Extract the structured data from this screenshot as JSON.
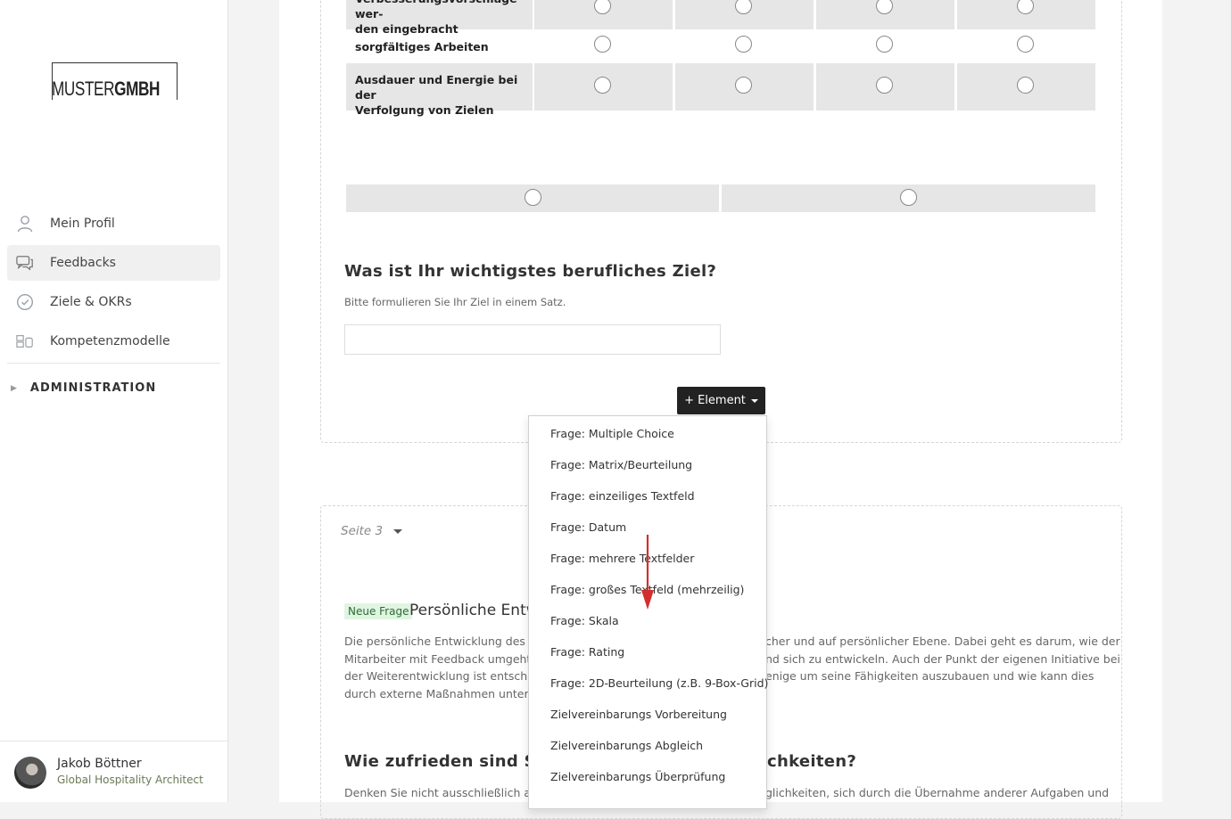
{
  "brand": {
    "logo_light": "MUSTER",
    "logo_bold": "GMBH"
  },
  "nav": {
    "items": [
      {
        "label": "Mein Profil",
        "icon": "user-icon"
      },
      {
        "label": "Feedbacks",
        "icon": "chat-icon",
        "active": true
      },
      {
        "label": "Ziele & OKRs",
        "icon": "check-circle-icon"
      },
      {
        "label": "Kompetenzmodelle",
        "icon": "blocks-icon"
      }
    ],
    "admin_label": "ADMINISTRATION"
  },
  "user": {
    "name": "Jakob Böttner",
    "role": "Global Hospitality Architect"
  },
  "matrix": {
    "rows": [
      {
        "label_line1": "Verbesserungsvorschläge wer-",
        "label_line2": "den eingebracht"
      },
      {
        "label_line1": "sorgfältiges Arbeiten",
        "label_line2": ""
      },
      {
        "label_line1": "Ausdauer und Energie bei der",
        "label_line2": "Verfolgung von Zielen"
      }
    ]
  },
  "question_goal": {
    "title": "Was ist Ihr wichtigstes berufliches Ziel?",
    "hint": "Bitte formulieren Sie Ihr Ziel in einem Satz.",
    "value": ""
  },
  "add_element": {
    "label": "+ Element",
    "menu": [
      "Frage: Multiple Choice",
      "Frage: Matrix/Beurteilung",
      "Frage: einzeiliges Textfeld",
      "Frage: Datum",
      "Frage: mehrere Textfelder",
      "Frage: großes Textfeld (mehrzeilig)",
      "Frage: Skala",
      "Frage: Rating",
      "Frage: 2D-Beurteilung (z.B. 9-Box-Grid)",
      "Zielvereinbarungs Vorbereitung",
      "Zielvereinbarungs Abgleich",
      "Zielvereinbarungs Überprüfung"
    ]
  },
  "page3": {
    "label": "Seite 3",
    "badge": "Neue Frage",
    "section_title": "Persönliche Entw",
    "para_left": [
      "Die persönliche Entwicklung des Mi",
      "Mitarbeiter mit Feedback umgeht u",
      "der Weiterentwicklung ist entscheid",
      "durch externe Maßnahmen unters"
    ],
    "para_right": [
      "cher und auf persönlicher Ebene. Dabei geht es darum, wie der",
      "nd sich zu entwickeln. Auch der Punkt der eigenen Initiative bei",
      "enige um seine Fähigkeiten auszubauen und wie kann dies",
      ""
    ],
    "question2_left": "Wie zufrieden sind Sie",
    "question2_right": "chkeiten?",
    "question2_hint_left": "Denken Sie nicht ausschließlich an Tr",
    "question2_hint_right": "glichkeiten, sich durch die Übernahme anderer Aufgaben und"
  },
  "annotation": {
    "arrow_color": "#d32f2f"
  }
}
